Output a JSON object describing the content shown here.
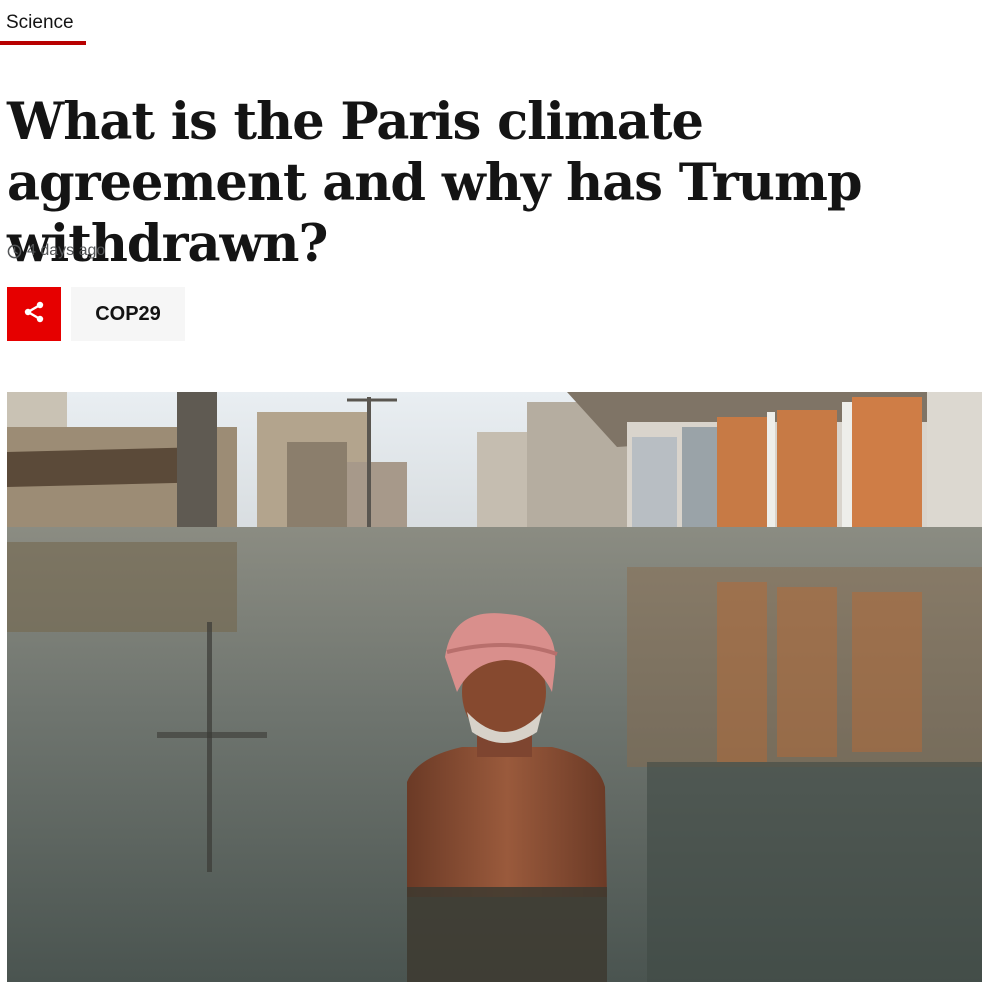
{
  "section": {
    "label": "Science"
  },
  "headline": "What is the Paris climate agreement and why has Trump withdrawn?",
  "meta": {
    "timestamp": "4 days ago",
    "clock_icon": "clock-icon"
  },
  "actions": {
    "share_icon": "share-icon",
    "topic_label": "COP29"
  },
  "hero_image": {
    "subject": "man-standing-in-floodwater-photo"
  },
  "colors": {
    "accent_red": "#b80000",
    "share_red": "#e60000",
    "topic_bg": "#f6f6f6",
    "text": "#141414",
    "meta_text": "#545658"
  }
}
